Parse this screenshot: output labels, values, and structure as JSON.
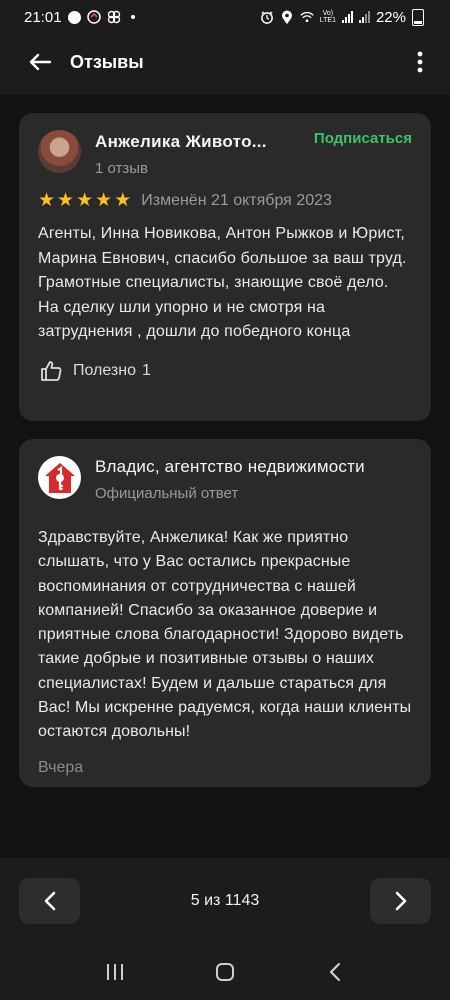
{
  "status_bar": {
    "time": "21:01",
    "battery": "22%",
    "network": "LTE1"
  },
  "app_bar": {
    "title": "Отзывы",
    "back_icon": "arrow-left-icon",
    "more_icon": "more-vert-icon"
  },
  "review": {
    "author": "Анжелика Живото...",
    "reviews_count": "1 отзыв",
    "subscribe_label": "Подписаться",
    "rating": 5,
    "edited": "Изменён 21 октября 2023",
    "text": "Агенты, Инна Новикова, Антон Рыжков и Юрист, Марина Евнович, спасибо большое за ваш труд. Грамотные специалисты, знающие своё дело. На сделку шли упорно и не смотря на затруднения , дошли до победного конца",
    "useful_label": "Полезно",
    "useful_count": "1"
  },
  "reply": {
    "company": "Владис, агентство недвижимости",
    "badge": "Официальный ответ",
    "text": "Здравствуйте, Анжелика! Как же приятно слышать, что у Вас остались прекрасные воспоминания от сотрудничества с нашей компанией!    Спасибо за оказанное доверие и приятные слова благодарности! Здорово видеть такие добрые и позитивные отзывы о наших специалистах! Будем и дальше стараться для Вас! Мы искренне радуемся, когда наши клиенты остаются довольны!",
    "date": "Вчера"
  },
  "pager": {
    "label": "5 из 1143"
  },
  "colors": {
    "accent_green": "#3bc36a",
    "star": "#fbbf24",
    "card": "#2a2a2a",
    "background": "#121212",
    "logo_red": "#d42a2a"
  }
}
